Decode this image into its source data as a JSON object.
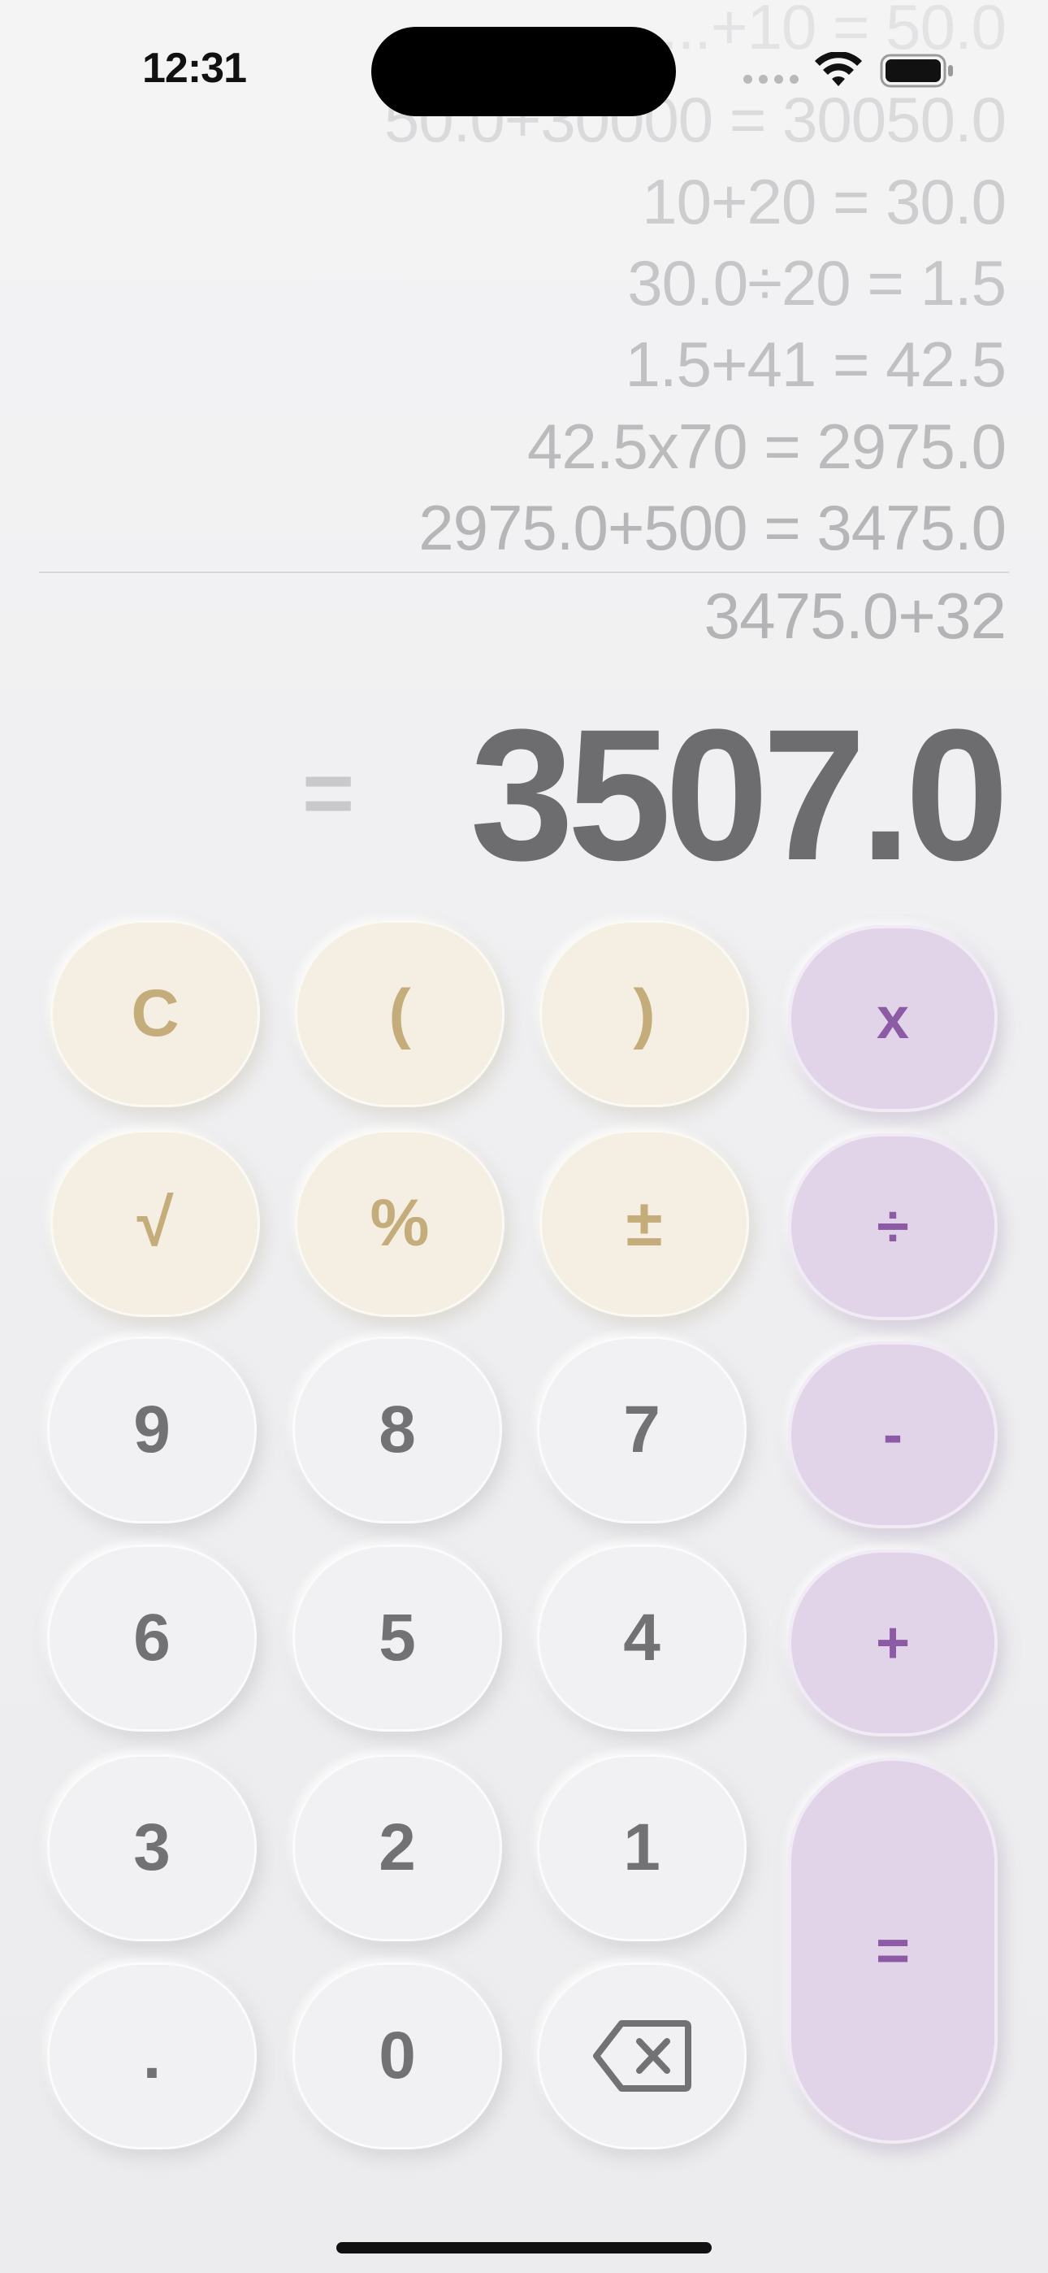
{
  "status_bar": {
    "time": "12:31"
  },
  "history": [
    {
      "text": "...+10 = 50.0"
    },
    {
      "text": "50.0+30000 = 30050.0"
    },
    {
      "text": "10+20 = 30.0"
    },
    {
      "text": "30.0÷20 = 1.5"
    },
    {
      "text": "1.5+41 = 42.5"
    },
    {
      "text": "42.5x70 = 2975.0"
    },
    {
      "text": "2975.0+500 = 3475.0"
    }
  ],
  "display": {
    "expression": "3475.0+32",
    "equals": "=",
    "result": "3507.0"
  },
  "keys": {
    "clear": "C",
    "open_paren": "(",
    "close_paren": ")",
    "multiply": "x",
    "sqrt": "√",
    "percent": "%",
    "plus_minus": "±",
    "divide": "÷",
    "nine": "9",
    "eight": "8",
    "seven": "7",
    "minus": "-",
    "six": "6",
    "five": "5",
    "four": "4",
    "plus": "+",
    "three": "3",
    "two": "2",
    "one": "1",
    "equals": "=",
    "decimal": ".",
    "zero": "0",
    "backspace_icon": "backspace-icon"
  },
  "colors": {
    "function_key_bg": "#f4efe2",
    "function_key_text": "#c5ac7b",
    "operator_key_bg": "#e1d3e8",
    "operator_key_text": "#8d5aa5",
    "number_key_bg": "#f1f1f3",
    "number_key_text": "#727274",
    "result_text": "#6d6d6f"
  }
}
